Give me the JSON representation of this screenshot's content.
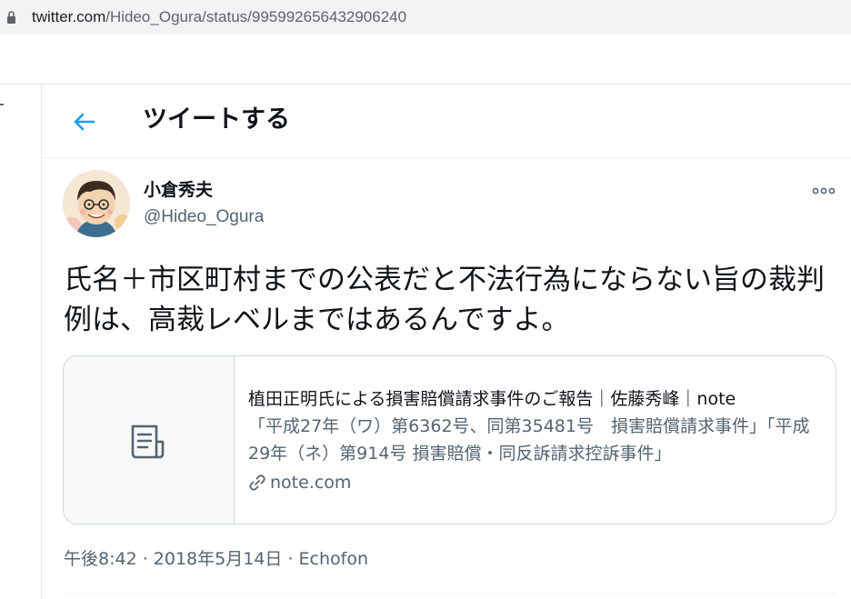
{
  "browser": {
    "url_host": "twitter.com",
    "url_path": "/Hideo_Ogura/status/995992656432906240"
  },
  "header": {
    "title": "ツイートする"
  },
  "tweet": {
    "author_name": "小倉秀夫",
    "author_handle": "@Hideo_Ogura",
    "text": "氏名＋市区町村までの公表だと不法行為にならない旨の裁判例は、高裁レベルまではあるんですよ。",
    "card": {
      "title": "植田正明氏による損害賠償請求事件のご報告｜佐藤秀峰｜note",
      "description": "「平成27年（ワ）第6362号、同第35481号　損害賠償請求事件」「平成29年（ネ）第914号 損害賠償・同反訴請求控訴事件」",
      "domain": "note.com"
    },
    "meta": "午後8:42 · 2018年5月14日 · Echofon"
  },
  "colors": {
    "accent": "#1d9bf0",
    "text_primary": "#0f1419",
    "text_secondary": "#536471",
    "border": "#cfd9de"
  },
  "icons": {
    "lock": "lock-icon",
    "back": "back-arrow-icon",
    "more": "more-icon",
    "document": "document-icon",
    "link": "link-icon"
  }
}
